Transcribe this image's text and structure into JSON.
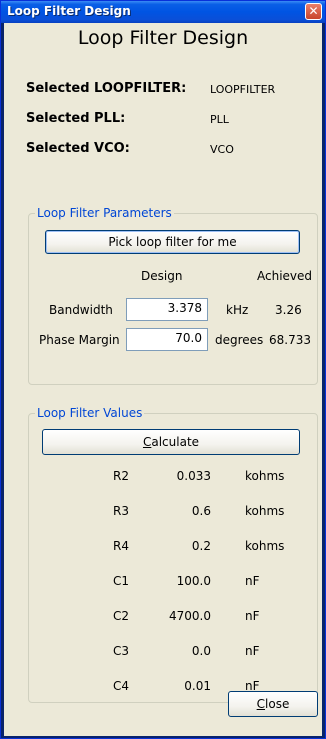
{
  "window": {
    "title": "Loop Filter Design",
    "close_glyph": "✕",
    "heading": "Loop Filter Design"
  },
  "selected": [
    {
      "label": "Selected LOOPFILTER:",
      "value": "LOOPFILTER"
    },
    {
      "label": "Selected PLL:",
      "value": "PLL"
    },
    {
      "label": "Selected VCO:",
      "value": "VCO"
    }
  ],
  "params": {
    "legend": "Loop Filter Parameters",
    "pick_button": "Pick loop filter for me",
    "design_header": "Design",
    "achieved_header": "Achieved",
    "bandwidth": {
      "label": "Bandwidth",
      "value": "3.378",
      "unit": "kHz",
      "achieved": "3.26"
    },
    "phase_margin": {
      "label": "Phase Margin",
      "value": "70.0",
      "unit": "degrees",
      "achieved": "68.733"
    }
  },
  "values": {
    "legend": "Loop Filter Values",
    "calculate_button": "Calculate",
    "calculate_mnemonic": "C",
    "calculate_rest": "alculate",
    "rows": [
      {
        "name": "R2",
        "value": "0.033",
        "unit": "kohms"
      },
      {
        "name": "R3",
        "value": "0.6",
        "unit": "kohms"
      },
      {
        "name": "R4",
        "value": "0.2",
        "unit": "kohms"
      },
      {
        "name": "C1",
        "value": "100.0",
        "unit": "nF"
      },
      {
        "name": "C2",
        "value": "4700.0",
        "unit": "nF"
      },
      {
        "name": "C3",
        "value": "0.0",
        "unit": "nF"
      },
      {
        "name": "C4",
        "value": "0.01",
        "unit": "nF"
      }
    ]
  },
  "footer": {
    "close_button": "Close",
    "close_mnemonic": "C",
    "close_rest": "lose"
  },
  "colors": {
    "titlebar": "#0054e3",
    "client_bg": "#ece9d8",
    "group_legend": "#0046d5"
  }
}
